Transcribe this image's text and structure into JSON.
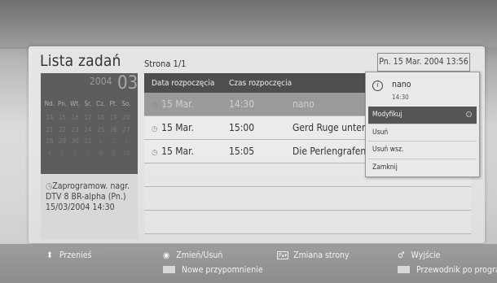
{
  "header": {
    "title": "Lista zadań",
    "page_info": "Strona 1/1",
    "datetime": "Pn. 15 Mar. 2004 13:56"
  },
  "calendar": {
    "year": "2004",
    "month": "03",
    "weekdays": [
      "Nd.",
      "Pn.",
      "Wt.",
      "Śr.",
      "Cz.",
      "Pt.",
      "So."
    ],
    "weeks": [
      [
        "14",
        "15",
        "16",
        "17",
        "18",
        "19",
        "20"
      ],
      [
        "21",
        "22",
        "23",
        "24",
        "25",
        "26",
        "27"
      ],
      [
        "28",
        "29",
        "30",
        "31",
        "1",
        "2",
        "3"
      ],
      [
        "4",
        "5",
        "6",
        "7",
        "8",
        "9",
        "10"
      ]
    ]
  },
  "note": {
    "text": "Zaprogramow. nagr. DTV 8 BR-alpha (Pn.) 15/03/2004 14:30"
  },
  "table": {
    "headers": [
      "Data rozpoczęcia",
      "Czas rozpoczęcia"
    ],
    "rows": [
      {
        "date": "15 Mar.",
        "time": "14:30",
        "title": "nano",
        "selected": true
      },
      {
        "date": "15 Mar.",
        "time": "15:00",
        "title": "Gerd Ruge unterwe",
        "selected": false
      },
      {
        "date": "15 Mar.",
        "time": "15:05",
        "title": "Die Perlengrafen",
        "selected": false
      }
    ]
  },
  "popup": {
    "program": "nano",
    "time": "14:30",
    "items": [
      "Modyfikuj",
      "Usuń",
      "Usuń wsz.",
      "Zamknij"
    ]
  },
  "legend": {
    "move": "Przenieś",
    "change_delete": "Zmień/Usuń",
    "page_change": "Zmiana strony",
    "exit": "Wyjście",
    "new_reminder": "Nowe przypomnienie",
    "program_guide": "Przewodnik po programach"
  }
}
